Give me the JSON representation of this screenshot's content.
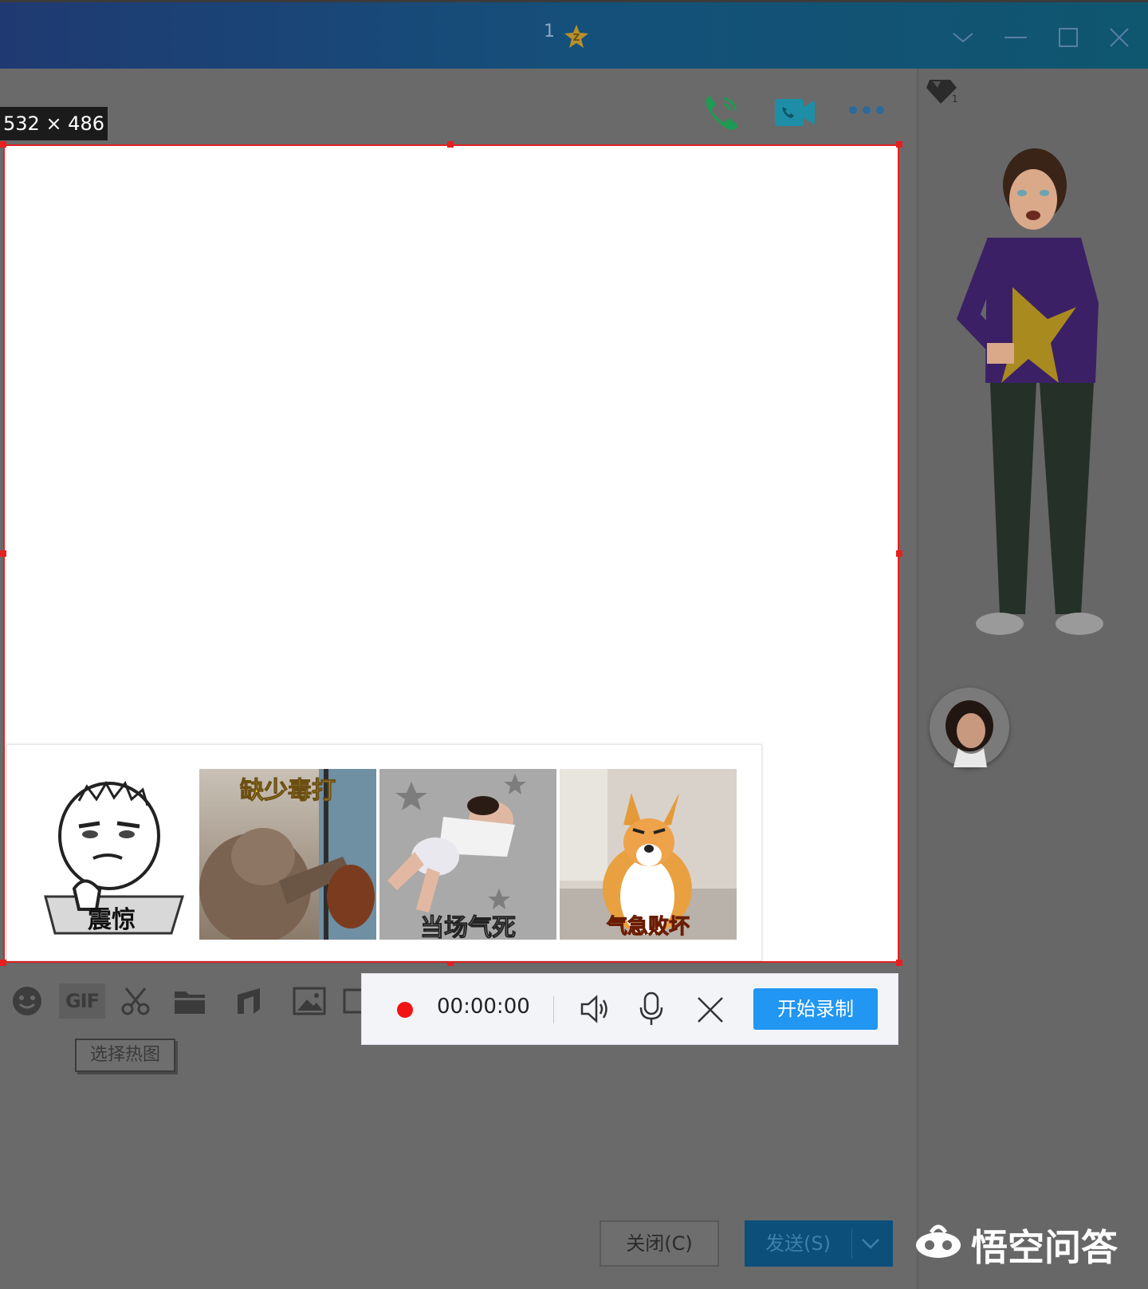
{
  "titlebar": {
    "count": "1",
    "badge_icon": "star-badge-icon"
  },
  "capture": {
    "size_label": "532 × 486"
  },
  "gif_panel": {
    "items": [
      {
        "caption": "震惊"
      },
      {
        "caption": "缺少毒打"
      },
      {
        "caption": "当场气死"
      },
      {
        "caption": "气急败坏"
      }
    ]
  },
  "toolbar": {
    "tooltip": "选择热图",
    "gif_label": "GIF"
  },
  "recorder": {
    "time": "00:00:00",
    "start_label": "开始录制"
  },
  "footer": {
    "close_label": "关闭(C)",
    "send_label": "发送(S)"
  },
  "watermark": {
    "text": "悟空问答"
  },
  "colors": {
    "accent": "#2196f3",
    "record": "#f01414",
    "selection": "#e52020"
  }
}
